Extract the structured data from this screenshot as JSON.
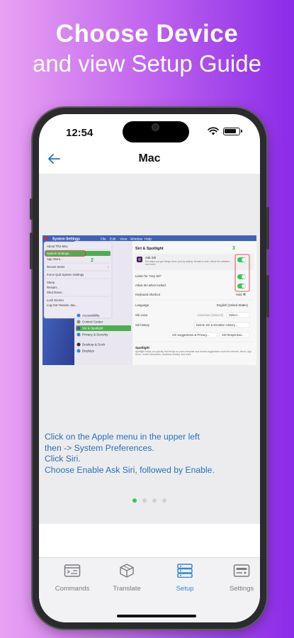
{
  "promo": {
    "title": "Choose Device",
    "subtitle": "and view Setup Guide"
  },
  "status_bar": {
    "time": "12:54"
  },
  "nav": {
    "title": "Mac"
  },
  "screenshot": {
    "menu_app": "System Settings",
    "menu_items": [
      "File",
      "Edit",
      "View",
      "Window",
      "Help"
    ],
    "apple_menu": [
      "About This Mac",
      "System Settings...",
      "App Store...",
      "Recent Items",
      "Force Quit System Settings",
      "Sleep",
      "Restart...",
      "Shut Down...",
      "Lock Screen",
      "Log Out Yassine Jaa..."
    ],
    "step2": "2",
    "step3": "3",
    "sidebar": [
      "Accessibility",
      "Control Center",
      "Siri & Spotlight",
      "Privacy & Security",
      "Desktop & Dock",
      "Displays"
    ],
    "panel_title": "Siri & Spotlight",
    "ask_siri": "Ask Siri",
    "ask_siri_desc": "Siri helps you get things done, just by asking. Dictate a note, check the weather, and more.",
    "listen": "Listen for \"Hey Siri\"",
    "allow_locked": "Allow Siri when locked",
    "keyboard_shortcut": "Keyboard shortcut",
    "keyboard_value": "Hold ⌘",
    "language": "Language",
    "language_value": "English (United States)",
    "voice": "Siri voice",
    "voice_value": "American (Voice 5)",
    "select": "Select...",
    "history": "Siri history",
    "history_btn": "Delete Siri & Dictation History...",
    "suggestions_btn": "Siri Suggestions & Privacy...",
    "responses_btn": "Siri Responses...",
    "spotlight": "Spotlight",
    "spotlight_desc": "Spotlight helps you quickly find things on your computer and shows suggestions from the Internet, Music, App Store, movie showtimes, locations nearby, and more."
  },
  "instructions": [
    "Click on the Apple menu in the upper left",
    "then -> System Preferences.",
    "Click Siri.",
    "Choose Enable Ask Siri, followed by Enable."
  ],
  "pager": {
    "count": 4,
    "active_index": 0
  },
  "tabs": [
    {
      "label": "Commands",
      "icon": "commands-icon"
    },
    {
      "label": "Translate",
      "icon": "cube-icon"
    },
    {
      "label": "Setup",
      "icon": "server-icon",
      "active": true
    },
    {
      "label": "Settings",
      "icon": "settings-card-icon"
    }
  ],
  "colors": {
    "accent_blue": "#2a6fb6",
    "active_tab": "#2d86d9",
    "active_dot": "#34c759",
    "highlight_red": "#e0282d"
  }
}
